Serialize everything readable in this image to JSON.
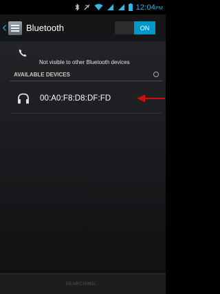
{
  "status_bar": {
    "time": "12:04",
    "ampm": "PM"
  },
  "action_bar": {
    "title": "Bluetooth",
    "toggle_label": "ON"
  },
  "this_device": {
    "visibility_text": "Not visible to other Bluetooth devices"
  },
  "available_devices": {
    "header": "AVAILABLE DEVICES",
    "items": [
      {
        "name": "00:A0:F8:D8:DF:FD",
        "icon": "headphones-icon"
      }
    ]
  },
  "footer": {
    "button_label": "SEARCHING..."
  },
  "colors": {
    "accent": "#33b5e5",
    "toggle_on": "#0099cc",
    "annotation_arrow": "#d01010"
  }
}
